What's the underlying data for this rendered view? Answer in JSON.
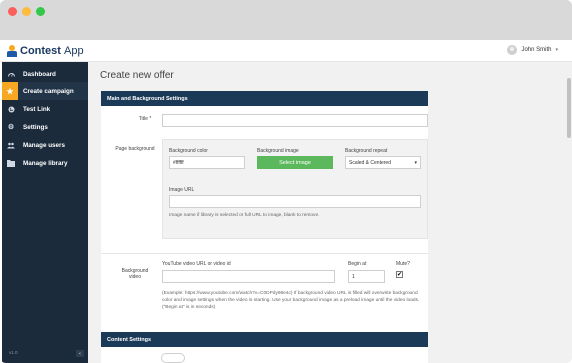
{
  "app": {
    "logo_name": "Contest",
    "logo_suffix": "App",
    "user_name": "John Smith",
    "version": "v1.0"
  },
  "sidebar": {
    "items": [
      {
        "label": "Dashboard",
        "icon": "dashboard-icon"
      },
      {
        "label": "Create campaign",
        "icon": "star-icon"
      },
      {
        "label": "Test Link",
        "icon": "globe-icon"
      },
      {
        "label": "Settings",
        "icon": "gears-icon"
      },
      {
        "label": "Manage users",
        "icon": "users-icon"
      },
      {
        "label": "Manage library",
        "icon": "library-icon"
      }
    ],
    "active_index": 1
  },
  "page": {
    "title": "Create new offer"
  },
  "main_settings": {
    "header": "Main and Background Settings",
    "title_label": "Title *",
    "title_value": "",
    "page_background_label": "Page background",
    "bg_color_label": "Background color",
    "bg_color_value": "#ffffff",
    "bg_image_label": "Background image",
    "select_image_button": "Select image",
    "bg_repeat_label": "Background repeat",
    "bg_repeat_value": "Scaled & Centered",
    "image_url_label": "Image URL",
    "image_url_value": "",
    "image_url_help": "Image name if library is selected or full URL to image, blank to remove.",
    "bg_video_label": "Background video",
    "youtube_label": "YouTube video URL or video id",
    "youtube_value": "",
    "begin_at_label": "Begin at",
    "begin_at_value": "1",
    "mute_label": "Mute?",
    "mute_checked": true,
    "video_help": "(Example: https://www.youtube.com/watch?v=C0DPdy98e4c) If background video URL is filled will overwrite background color and image settings when the video is starting. Use your background image as a preload image until the video loads. (\"Begin at\" is in seconds)"
  },
  "content_settings": {
    "header": "Content Settings"
  }
}
